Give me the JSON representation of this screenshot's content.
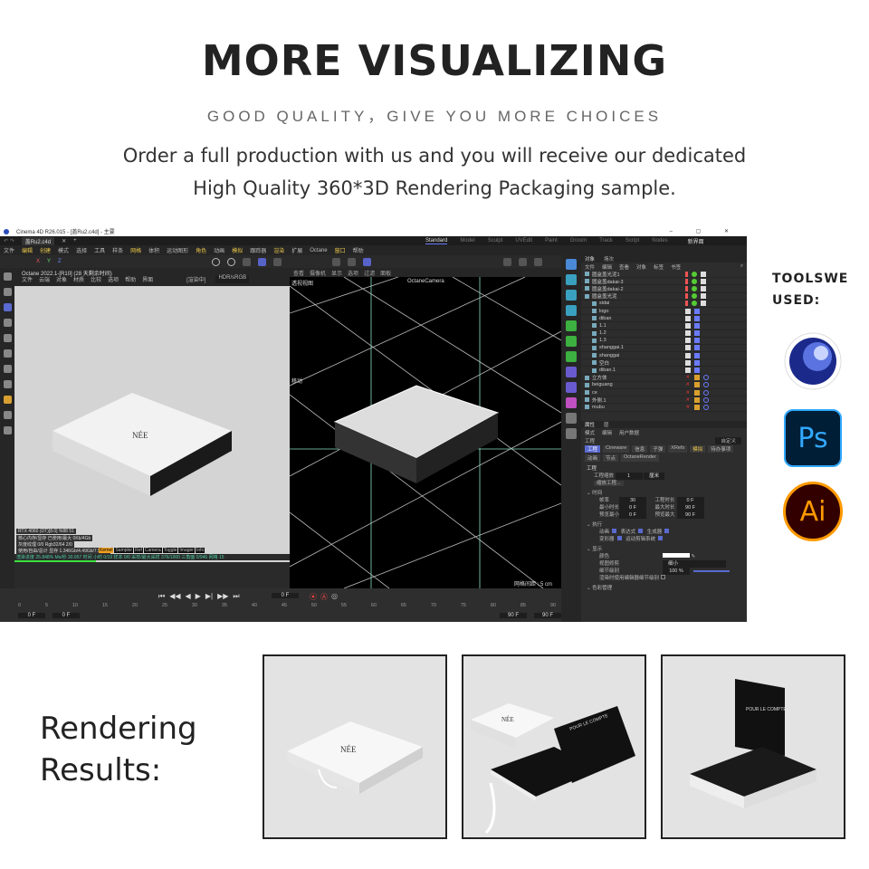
{
  "header": {
    "title": "MORE VISUALIZING",
    "subtitle": "GOOD QUALITY，GIVE YOU MORE CHOICES",
    "line1": "Order a full production with us and you will receive our dedicated",
    "line2": "High Quality 360*3D Rendering Packaging sample."
  },
  "app": {
    "window_title": "Cinema 4D R26.015 - [盖Ru2.c4d] - 主要",
    "file_tab": "盖Ru2.c4d",
    "layouts": [
      "Standard",
      "Model",
      "Sculpt",
      "UVEdit",
      "Paint",
      "Groom",
      "Track",
      "Script",
      "Nodes"
    ],
    "new_interface": "新界面",
    "menu": [
      "文件",
      "编辑",
      "创建",
      "模式",
      "选择",
      "工具",
      "样条",
      "网格",
      "体积",
      "运动图形",
      "角色",
      "动画",
      "模拟",
      "跟踪器",
      "渲染",
      "扩展",
      "Octane",
      "窗口",
      "帮助"
    ],
    "axes": [
      "X",
      "Y",
      "Z"
    ],
    "octane_title": "Octane 2022.1-[R10]    (28 天剩余时间)",
    "octane_menu": [
      "文件",
      "云端",
      "对象",
      "材质",
      "比较",
      "选项",
      "帮助",
      "界面"
    ],
    "octane_status": "[渲染中]",
    "octane_mode": "HDR/sRGB",
    "octane_info": [
      "RTX 4060 (DT)[8.0]   %88   51",
      "核心内存/显存 已使用/最大 0Kb/4Gb",
      "灰度纹理 0/0   Rgb32/64 2/0",
      "使用/自由/总计 显存 1.346Gb/4.49Gb/7.99Gb",
      "渲染进度 25.848%  Ms/秒 30.957  时间 小时 0/19  样本 0/0  采样/最大采样 376/1000  三角面 0/946  网格 15"
    ],
    "octane_tags": [
      "Kernel",
      "Sampler",
      "Ref",
      "Camera",
      "Toggle",
      "Imager",
      "Info"
    ],
    "right_viewport": {
      "menu": [
        "查看",
        "摄像机",
        "显示",
        "选项",
        "过滤",
        "面板"
      ],
      "name": "透视视图",
      "camera": "OctaneCamera",
      "move_label": "移动",
      "grid_info": "网格间距 : 5 cm"
    },
    "timeline": {
      "ticks": [
        "0",
        "5",
        "10",
        "15",
        "20",
        "25",
        "30",
        "35",
        "40",
        "45",
        "50",
        "55",
        "60",
        "65",
        "70",
        "75",
        "80",
        "85",
        "90"
      ],
      "start": "0 F",
      "start2": "0 F",
      "current": "0 F",
      "end": "90 F",
      "end2": "90 F"
    },
    "object_manager": {
      "tabs": [
        "对象",
        "场次"
      ],
      "menu": [
        "文件",
        "编辑",
        "查看",
        "对象",
        "标签",
        "书签"
      ],
      "objects": [
        "圆盒盖光泥1",
        "圆盒盖dakai-3",
        "圆盒盖dakai-2",
        "圆盒盖光泥",
        "sidai",
        "logo",
        "diban",
        "1.1",
        "1.2",
        "1.3",
        "shanggai.1",
        "shanggai",
        "空白",
        "diban.1",
        "立方体",
        "beiguang",
        "ce",
        "外侧.1",
        "mubu"
      ]
    },
    "attributes": {
      "tabs_top": [
        "属性",
        "层"
      ],
      "menu": [
        "模式",
        "编辑",
        "用户数据"
      ],
      "section": "工程",
      "preset": "自定义",
      "tabs": [
        "工程",
        "Cineware",
        "信息",
        "子弹",
        "XRefs",
        "模拟",
        "待办事项",
        "动画",
        "节点",
        "OctaneRender"
      ],
      "project_scale_label": "工程缩放",
      "project_scale": "1",
      "unit": "厘米",
      "scale_btn": "缩放工程...",
      "time_group": "时间",
      "fps_label": "帧率",
      "fps": "30",
      "proj_time_label": "工程时长",
      "proj_time": "0 F",
      "min_label": "最小时长",
      "min": "0 F",
      "max_label": "最大时长",
      "max": "90 F",
      "pmin_label": "预览最小",
      "pmin": "0 F",
      "pmax_label": "预览最大",
      "pmax": "90 F",
      "exec_group": "执行",
      "exec": [
        "动画",
        "表达式",
        "生成器",
        "变形器",
        "运动剪辑系统"
      ],
      "display_group": "显示",
      "color_label": "颜色",
      "viewport_label": "视图修剪",
      "viewport_value": "细小",
      "lod_label": "细节级别",
      "lod": "100 %",
      "lod_fraction": 1.0,
      "render_lod": "渲染时使用编辑器细节级别",
      "color_mgmt": "色彩管理"
    }
  },
  "tools": {
    "label_line1": "TOOLSWE",
    "label_line2": "USED:",
    "items": [
      {
        "name": "Cinema 4D",
        "glyph": "cinema4d-icon"
      },
      {
        "name": "Ps",
        "color": "#31a8ff",
        "bg": "#001e36"
      },
      {
        "name": "Ai",
        "color": "#ff9a00",
        "bg": "#330000"
      }
    ]
  },
  "results": {
    "line1": "Rendering",
    "line2": "Results:",
    "box_logo": "NÉE",
    "box_inner_text": "POUR LE COMPTE"
  }
}
